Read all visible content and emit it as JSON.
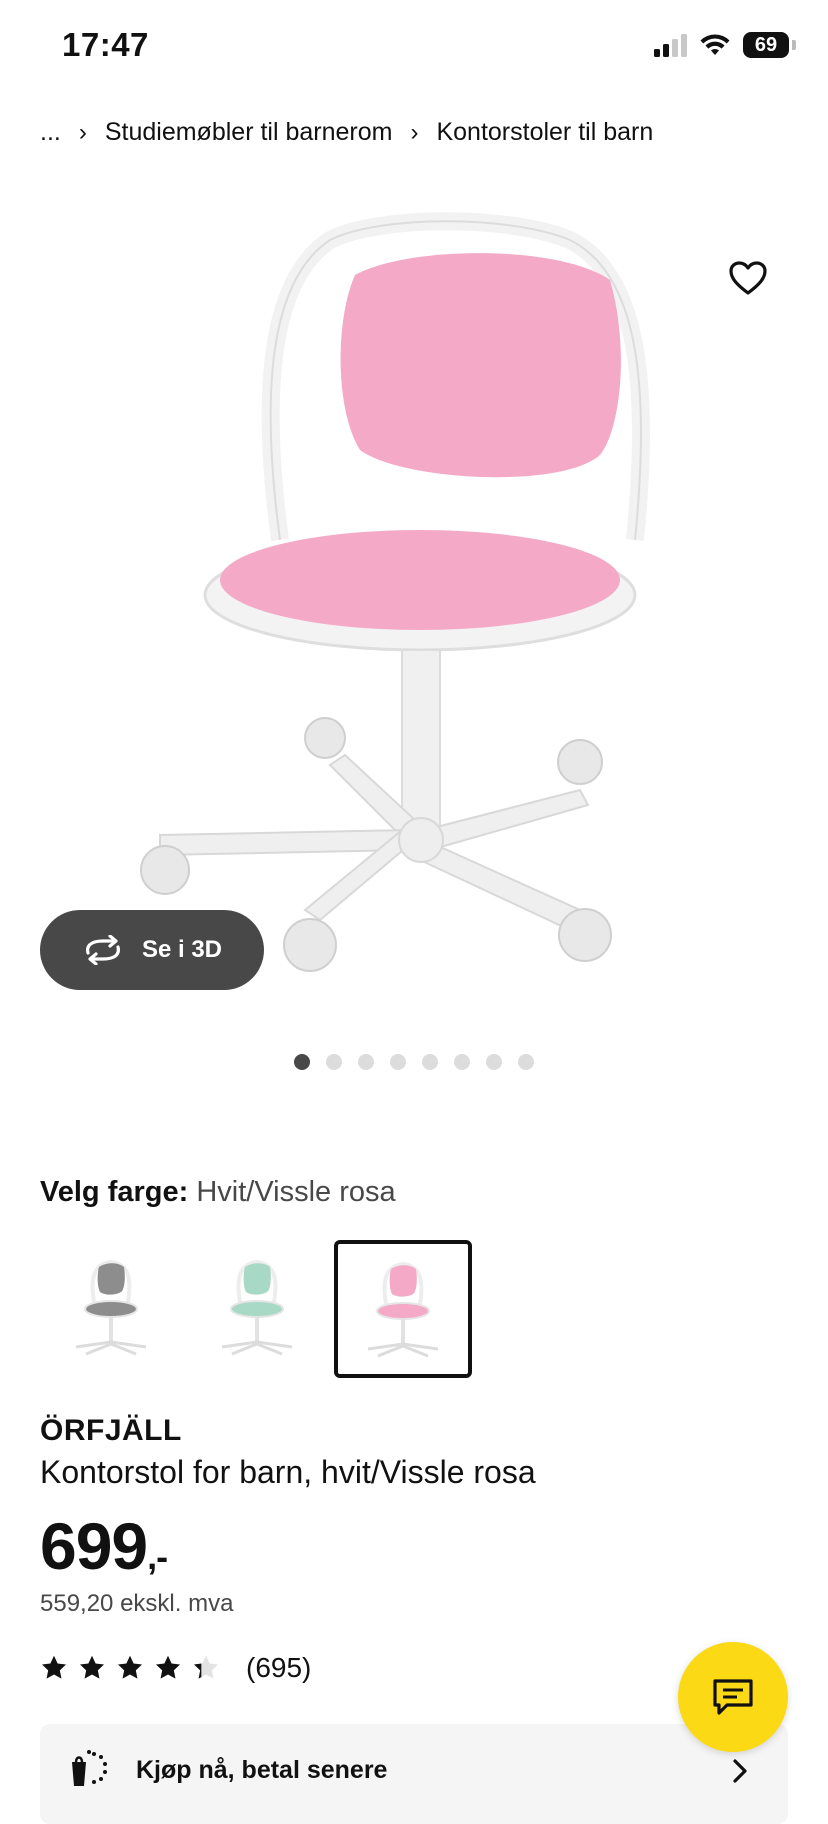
{
  "status_bar": {
    "time": "17:47",
    "battery": "69"
  },
  "breadcrumb": {
    "ellipsis": "...",
    "items": [
      "Studiemøbler til barnerom",
      "Kontorstoler til barn"
    ]
  },
  "gallery": {
    "view_3d_label": "Se i 3D",
    "image_count": 8,
    "active_index": 0
  },
  "color_select": {
    "label": "Velg farge:",
    "value": "Hvit/Vissle rosa",
    "swatches": [
      {
        "name": "grey",
        "color": "#8d8d8d",
        "selected": false
      },
      {
        "name": "green",
        "color": "#a8d8c6",
        "selected": false
      },
      {
        "name": "pink",
        "color": "#f4a9c6",
        "selected": true
      }
    ]
  },
  "product": {
    "name": "ÖRFJÄLL",
    "description": "Kontorstol for barn, hvit/Vissle rosa",
    "price": "699",
    "price_suffix": ",-",
    "price_ex_vat": "559,20 ekskl. mva",
    "rating": 4.3,
    "review_count": "(695)"
  },
  "bnpl": {
    "label": "Kjøp nå, betal senere"
  },
  "colors": {
    "accent_yellow": "#fbd914",
    "dark_button": "#484848",
    "pink": "#f4a9c6"
  }
}
